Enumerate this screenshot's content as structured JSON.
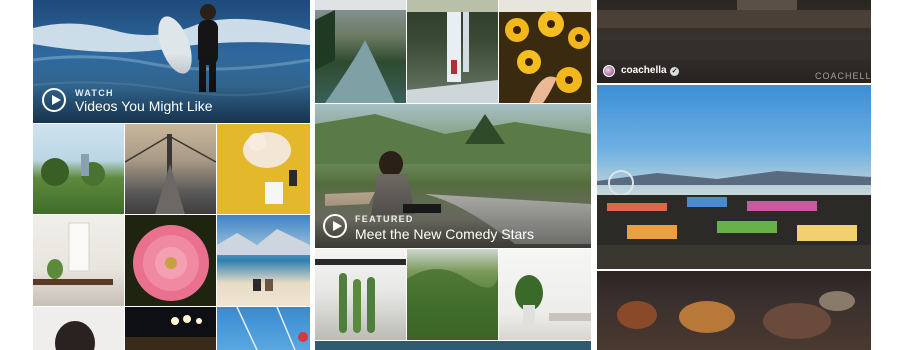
{
  "left_panel": {
    "featured": {
      "kicker": "WATCH",
      "title": "Videos You Might Like",
      "icon": "play-icon"
    }
  },
  "middle_panel": {
    "featured": {
      "kicker": "FEATURED",
      "title": "Meet the New Comedy Stars",
      "icon": "play-icon"
    }
  },
  "right_panel": {
    "top_post": {
      "account": "coachella",
      "verified_icon": "verified-check-icon",
      "watermark": "COACHELLA"
    }
  },
  "colors": {
    "background": "#ffffff",
    "overlay_text": "#ffffff"
  }
}
